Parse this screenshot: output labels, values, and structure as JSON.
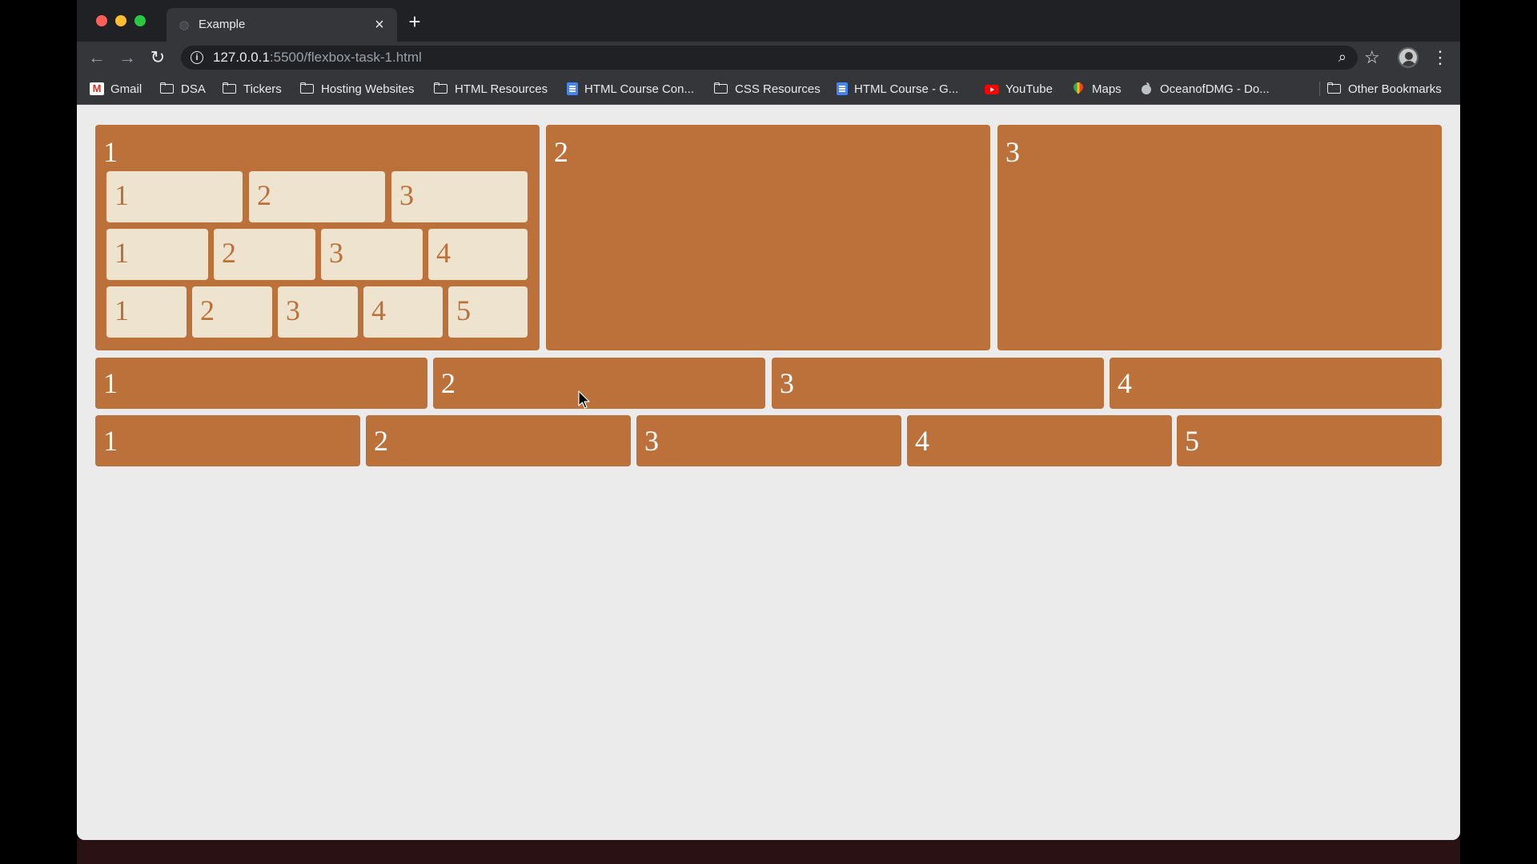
{
  "browser": {
    "tab_title": "Example",
    "url_host": "127.0.0.1",
    "url_rest": ":5500/flexbox-task-1.html",
    "icons": {
      "back": "arrow-left-icon",
      "forward": "arrow-right-icon",
      "reload": "reload-icon",
      "info": "info-icon",
      "zoom": "zoom-icon",
      "star": "star-icon",
      "menu": "menu-dots-icon"
    },
    "tab_close_glyph": "×",
    "new_tab_glyph": "+"
  },
  "bookmarks": [
    {
      "label": "Gmail",
      "icon": "gmail-icon"
    },
    {
      "label": "DSA",
      "icon": "folder-icon"
    },
    {
      "label": "Tickers",
      "icon": "folder-icon"
    },
    {
      "label": "Hosting Websites",
      "icon": "folder-icon"
    },
    {
      "label": "HTML Resources",
      "icon": "folder-icon"
    },
    {
      "label": "HTML Course Con...",
      "icon": "doc-icon"
    },
    {
      "label": "CSS Resources",
      "icon": "folder-icon"
    },
    {
      "label": "HTML Course - G...",
      "icon": "doc-icon"
    },
    {
      "label": "YouTube",
      "icon": "youtube-icon"
    },
    {
      "label": "Maps",
      "icon": "maps-icon"
    },
    {
      "label": "OceanofDMG - Do...",
      "icon": "apple-icon"
    },
    {
      "label": "Other Bookmarks",
      "icon": "folder-icon"
    }
  ],
  "page": {
    "colors": {
      "box": "#bc713b",
      "inner_box": "#ede3ce",
      "background": "#ebebeb"
    },
    "row1": {
      "box1": {
        "label": "1",
        "nested_row_a": [
          "1",
          "2",
          "3"
        ],
        "nested_row_b": [
          "1",
          "2",
          "3",
          "4"
        ],
        "nested_row_c": [
          "1",
          "2",
          "3",
          "4",
          "5"
        ]
      },
      "box2": {
        "label": "2"
      },
      "box3": {
        "label": "3"
      }
    },
    "row2": [
      "1",
      "2",
      "3",
      "4"
    ],
    "row3": [
      "1",
      "2",
      "3",
      "4",
      "5"
    ]
  }
}
